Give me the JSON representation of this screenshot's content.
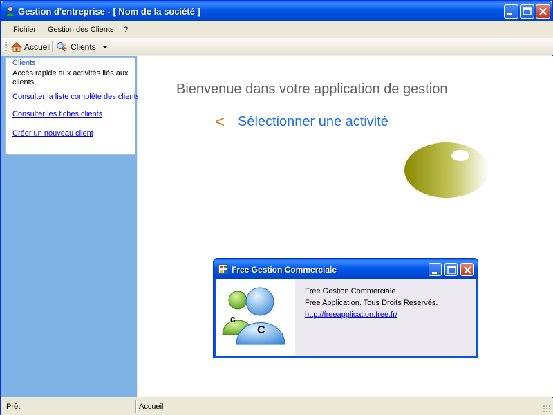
{
  "window": {
    "title": "Gestion d'entreprise - [ Nom de la société ]",
    "minimize_icon": "minimize-icon",
    "maximize_icon": "maximize-icon",
    "close_icon": "close-icon"
  },
  "menubar": {
    "items": [
      "Fichier",
      "Gestion des Clients",
      "?"
    ]
  },
  "toolbar": {
    "home_label": "Accueil",
    "home_icon": "house-icon",
    "clients_label": "Clients",
    "clients_icon": "magnifier-user-icon",
    "dropdown_icon": "dropdown-arrow-icon"
  },
  "sidebar": {
    "group_title": "Clients",
    "description": "Accés rapide aux activités liés aux clients",
    "links": [
      "Consulter la liste complête des clients",
      "Consulter les fiches clients",
      "Créer un nouveau client"
    ]
  },
  "main": {
    "welcome": "Bienvenue dans votre application de gestion",
    "arrow": "<",
    "select_activity": "Sélectionner une activité",
    "colors": {
      "accent_arrow": "#e07a10",
      "accent_text": "#1f6fe0",
      "sidebar_bg": "#7fb3e6"
    }
  },
  "about_dialog": {
    "title": "Free Gestion Commerciale",
    "line1": "Free Gestion Commerciale",
    "line2": "Free Application. Tous Droits Reservés.",
    "link": "http://freeapplication.free.fr/",
    "logo_letters": [
      "G",
      "C"
    ]
  },
  "statusbar": {
    "status": "Prêt",
    "location": "Accueil"
  }
}
